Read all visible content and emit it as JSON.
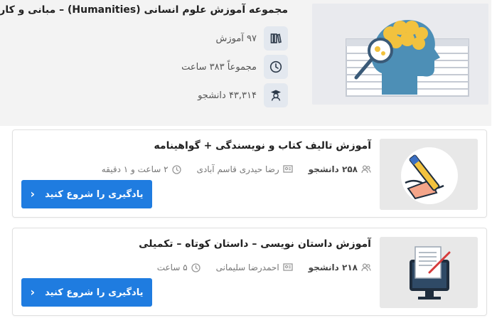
{
  "collection": {
    "title": "مجموعه آموزش علوم انسانی (Humanities) – مبانی و کاربردی",
    "courses_count": "۹۷ آموزش",
    "total_hours": "مجموعاً ۳۸۳ ساعت",
    "students": "۴۳,۳۱۴ دانشجو",
    "icons": [
      "books-icon",
      "clock-icon",
      "student-icon"
    ]
  },
  "courses": [
    {
      "title": "آموزش تالیف کتاب و نویسندگی + گواهینامه",
      "students": "۲۵۸ دانشجو",
      "instructor": "رضا حیدری قاسم آبادی",
      "duration": "۲ ساعت و ۱ دقیقه",
      "cta": "یادگیری را شروع کنید"
    },
    {
      "title": "آموزش داستان نویسی – داستان کوتاه – تکمیلی",
      "students": "۲۱۸ دانشجو",
      "instructor": "احمدرضا سلیمانی",
      "duration": "۵ ساعت",
      "cta": "یادگیری را شروع کنید"
    }
  ],
  "colors": {
    "accent": "#1f7ce0",
    "header_bg": "#f3f3f3",
    "icon_box": "#e3e8ef"
  }
}
